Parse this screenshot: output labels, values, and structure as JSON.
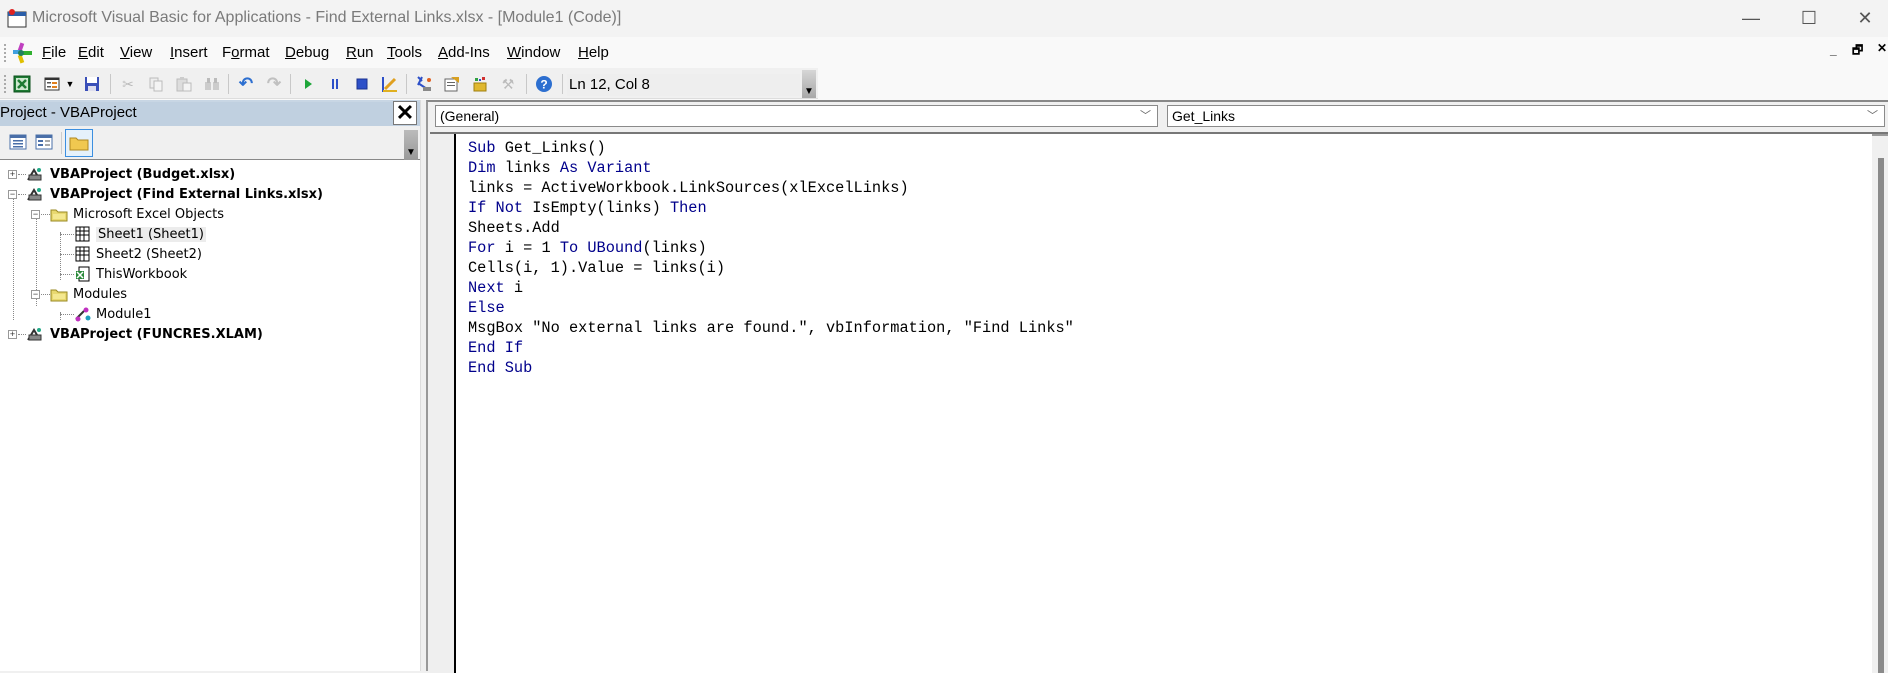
{
  "window": {
    "title": "Microsoft Visual Basic for Applications - Find External Links.xlsx - [Module1 (Code)]",
    "controls": {
      "minimize": "—",
      "maximize": "☐",
      "close": "✕"
    },
    "mdi_controls": {
      "minimize": "_",
      "restore": "🗗",
      "close": "✕"
    }
  },
  "menu": {
    "items": [
      {
        "label": "File",
        "accel": "F",
        "rest": "ile"
      },
      {
        "label": "Edit",
        "accel": "E",
        "rest": "dit"
      },
      {
        "label": "View",
        "accel": "V",
        "rest": "iew"
      },
      {
        "label": "Insert",
        "accel": "I",
        "rest": "nsert"
      },
      {
        "label": "Format",
        "pre": "F",
        "accel": "o",
        "rest": "rmat"
      },
      {
        "label": "Debug",
        "accel": "D",
        "rest": "ebug"
      },
      {
        "label": "Run",
        "accel": "R",
        "rest": "un"
      },
      {
        "label": "Tools",
        "accel": "T",
        "rest": "ools"
      },
      {
        "label": "Add-Ins",
        "accel": "A",
        "rest": "dd-Ins"
      },
      {
        "label": "Window",
        "accel": "W",
        "rest": "indow"
      },
      {
        "label": "Help",
        "accel": "H",
        "rest": "elp"
      }
    ]
  },
  "toolbar": {
    "buttons": [
      {
        "name": "view-excel",
        "icon": "excel-icon",
        "enabled": true
      },
      {
        "name": "insert-userform",
        "icon": "userform-icon",
        "enabled": true
      },
      {
        "name": "insert-dropdown",
        "icon": "dropdown-arrow-icon",
        "enabled": true
      },
      {
        "name": "save",
        "icon": "save-icon",
        "enabled": true
      },
      {
        "name": "cut",
        "icon": "cut-icon",
        "enabled": false
      },
      {
        "name": "copy",
        "icon": "copy-icon",
        "enabled": false
      },
      {
        "name": "paste",
        "icon": "paste-icon",
        "enabled": false
      },
      {
        "name": "find",
        "icon": "find-icon",
        "enabled": false
      },
      {
        "name": "undo",
        "icon": "undo-icon",
        "enabled": true
      },
      {
        "name": "redo",
        "icon": "redo-icon",
        "enabled": false
      },
      {
        "name": "run",
        "icon": "run-icon",
        "enabled": true
      },
      {
        "name": "break",
        "icon": "pause-icon",
        "enabled": true
      },
      {
        "name": "reset",
        "icon": "stop-icon",
        "enabled": true
      },
      {
        "name": "design-mode",
        "icon": "design-mode-icon",
        "enabled": true
      },
      {
        "name": "project-explorer",
        "icon": "project-explorer-icon",
        "enabled": true
      },
      {
        "name": "properties-window",
        "icon": "properties-icon",
        "enabled": true
      },
      {
        "name": "object-browser",
        "icon": "object-browser-icon",
        "enabled": true
      },
      {
        "name": "toolbox",
        "icon": "toolbox-icon",
        "enabled": false
      },
      {
        "name": "help",
        "icon": "help-icon",
        "enabled": true
      }
    ],
    "status": "Ln 12, Col 8"
  },
  "project_panel": {
    "title": "Project - VBAProject",
    "close": "✕",
    "tree": [
      {
        "label": "VBAProject (Budget.xlsx)",
        "level": 0,
        "bold": true,
        "expander": "+",
        "icon": "vba-project-icon"
      },
      {
        "label": "VBAProject (Find External Links.xlsx)",
        "level": 0,
        "bold": true,
        "expander": "−",
        "icon": "vba-project-icon"
      },
      {
        "label": "Microsoft Excel Objects",
        "level": 1,
        "bold": false,
        "expander": "−",
        "icon": "folder-icon"
      },
      {
        "label": "Sheet1 (Sheet1)",
        "level": 2,
        "bold": false,
        "selected": true,
        "icon": "worksheet-icon"
      },
      {
        "label": "Sheet2 (Sheet2)",
        "level": 2,
        "bold": false,
        "icon": "worksheet-icon"
      },
      {
        "label": "ThisWorkbook",
        "level": 2,
        "bold": false,
        "icon": "workbook-icon"
      },
      {
        "label": "Modules",
        "level": 1,
        "bold": false,
        "expander": "−",
        "icon": "folder-icon"
      },
      {
        "label": "Module1",
        "level": 2,
        "bold": false,
        "icon": "module-icon"
      },
      {
        "label": "VBAProject (FUNCRES.XLAM)",
        "level": 0,
        "bold": true,
        "expander": "+",
        "icon": "vba-project-icon"
      }
    ]
  },
  "code_window": {
    "object_dropdown": "(General)",
    "procedure_dropdown": "Get_Links",
    "keyword_color": "#00008b",
    "lines": [
      [
        {
          "t": "Sub",
          "k": true
        },
        {
          "t": " Get_Links()"
        }
      ],
      [
        {
          "t": "Dim",
          "k": true
        },
        {
          "t": " links "
        },
        {
          "t": "As Variant",
          "k": true
        }
      ],
      [
        {
          "t": "links = ActiveWorkbook.LinkSources(xlExcelLinks)"
        }
      ],
      [
        {
          "t": "If Not",
          "k": true
        },
        {
          "t": " IsEmpty(links) "
        },
        {
          "t": "Then",
          "k": true
        }
      ],
      [
        {
          "t": "Sheets.Add"
        }
      ],
      [
        {
          "t": "For",
          "k": true
        },
        {
          "t": " i = 1 "
        },
        {
          "t": "To UBound",
          "k": true
        },
        {
          "t": "(links)"
        }
      ],
      [
        {
          "t": "Cells(i, 1).Value = links(i)"
        }
      ],
      [
        {
          "t": "Next",
          "k": true
        },
        {
          "t": " i"
        }
      ],
      [
        {
          "t": "Else",
          "k": true
        }
      ],
      [
        {
          "t": "MsgBox \"No external links are found.\", vbInformation, \"Find Links\""
        }
      ],
      [
        {
          "t": "End If",
          "k": true
        }
      ],
      [
        {
          "t": "End Sub",
          "k": true
        }
      ]
    ]
  }
}
